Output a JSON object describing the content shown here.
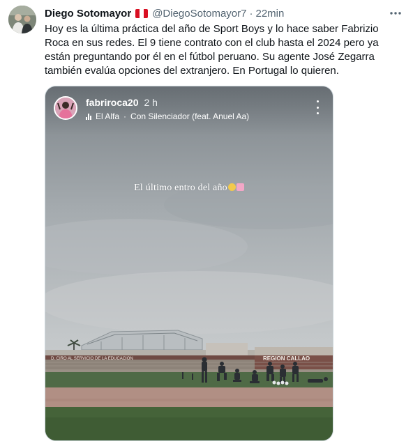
{
  "tweet": {
    "display_name": "Diego Sotomayor",
    "handle": "@DiegoSotomayor7",
    "separator": "·",
    "time": "22min",
    "more_icon": "more-horizontal-icon",
    "text": "Hoy es la última práctica del año de Sport Boys y lo hace saber Fabrizio Roca en sus redes. El 9 tiene contrato con el club hasta el 2024 pero ya están preguntando por él en el fútbol peruano. Su agente José Zegarra también evalúa opciones del extranjero. En Portugal lo quieren.",
    "flag_colors": [
      "#d91023",
      "#ffffff",
      "#d91023"
    ]
  },
  "story": {
    "username": "fabriroca20",
    "time": "2 h",
    "music_artist": "El Alfa",
    "music_separator": "·",
    "music_track": "Con Silenciador (feat. Anuel Aa)",
    "caption": "El último entro del año",
    "caption_emojis": [
      "pleading-face-emoji",
      "pink-jersey-emoji"
    ],
    "stadium_sign_left": "D. CIRO  AL SERVICIO DE LA EDUCACION",
    "stadium_sign_right": "REGION CALLAO"
  }
}
